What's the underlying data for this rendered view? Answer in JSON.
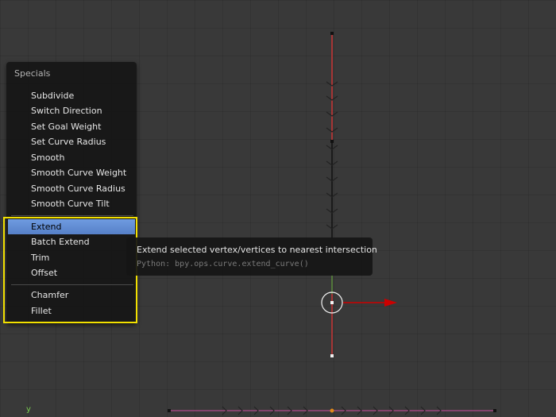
{
  "menu": {
    "title": "Specials",
    "items": [
      {
        "label": "Subdivide",
        "active": false
      },
      {
        "label": "Switch Direction",
        "active": false
      },
      {
        "label": "Set Goal Weight",
        "active": false
      },
      {
        "label": "Set Curve Radius",
        "active": false
      },
      {
        "label": "Smooth",
        "active": false
      },
      {
        "label": "Smooth Curve Weight",
        "active": false
      },
      {
        "label": "Smooth Curve Radius",
        "active": false
      },
      {
        "label": "Smooth Curve Tilt",
        "active": false
      },
      {
        "label": "Extend",
        "active": true
      },
      {
        "label": "Batch Extend",
        "active": false
      },
      {
        "label": "Trim",
        "active": false
      },
      {
        "label": "Offset",
        "active": false
      },
      {
        "label": "Chamfer",
        "active": false
      },
      {
        "label": "Fillet",
        "active": false
      }
    ]
  },
  "tooltip": {
    "description": "Extend selected vertex/vertices to nearest intersection",
    "python": "Python: bpy.ops.curve.extend_curve()"
  },
  "viewport": {
    "axis_label": "y"
  },
  "colors": {
    "highlight_outline": "#f2e000",
    "menu_active": "#5680c8",
    "curve_red": "#c93434",
    "curve_black": "#111111",
    "curve_pink": "#b04a8a",
    "arrow_red": "#cc0000",
    "axis_green": "#7cd152"
  }
}
